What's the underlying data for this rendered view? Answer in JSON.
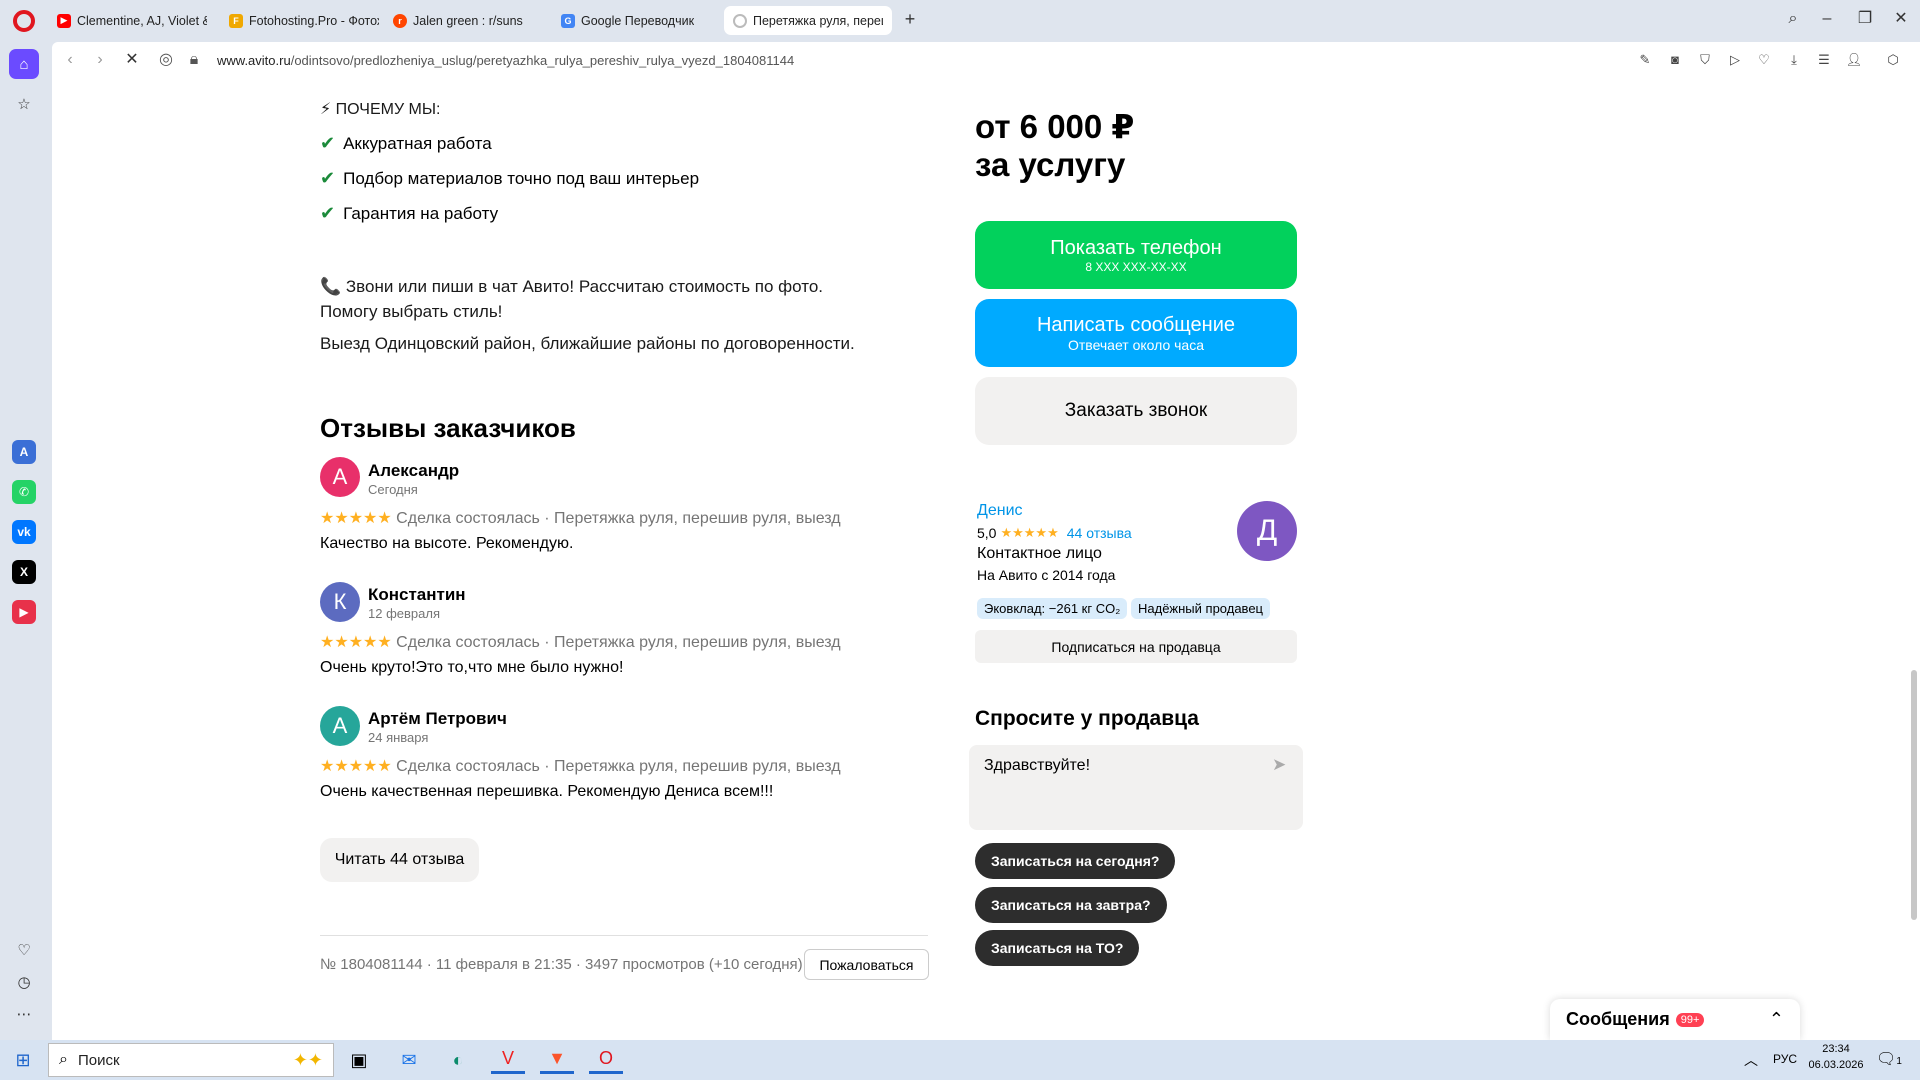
{
  "browser": {
    "tabs": [
      {
        "title": "Clementine, AJ, Violet & L",
        "favicon_color": "#ff0000",
        "favicon": "▶"
      },
      {
        "title": "Fotohosting.Pro - Фотохо",
        "favicon_color": "#f0a800",
        "favicon": "F"
      },
      {
        "title": "Jalen green : r/suns",
        "favicon_color": "#ff4500",
        "favicon": "r"
      },
      {
        "title": "Google Переводчик",
        "favicon_color": "#4285f4",
        "favicon": "G"
      },
      {
        "title": "Перетяжка руля, переши",
        "favicon_color": "#cccccc",
        "favicon": "○"
      }
    ],
    "new_tab": "+",
    "url_host": "www.avito.ru",
    "url_path": "/odintsovo/predlozheniya_uslug/peretyazhka_rulya_pereshiv_rulya_vyezd_1804081144"
  },
  "description": {
    "why_title": "⚡ ПОЧЕМУ МЫ:",
    "bullets": [
      "Аккуратная работа",
      "Подбор материалов точно под ваш интерьер",
      "Гарантия на работу"
    ],
    "call_text": "📞 Звони или пиши в чат Авито! Рассчитаю стоимость по фото. Помогу выбрать стиль!",
    "area_text": "Выезд Одинцовский район, ближайшие районы по договоренности."
  },
  "reviews": {
    "title": "Отзывы заказчиков",
    "items": [
      {
        "initial": "А",
        "avatar_color": "#e8306a",
        "name": "Александр",
        "date": "Сегодня",
        "stars": "★★★★★",
        "deal": "Сделка состоялась · Перетяжка руля, перешив руля, выезд",
        "text": "Качество на высоте. Рекомендую."
      },
      {
        "initial": "К",
        "avatar_color": "#5c6bc0",
        "name": "Константин",
        "date": "12 февраля",
        "stars": "★★★★★",
        "deal": "Сделка состоялась · Перетяжка руля, перешив руля, выезд",
        "text": "Очень круто!Это то,что мне было нужно!"
      },
      {
        "initial": "А",
        "avatar_color": "#26a69a",
        "name": "Артём Петрович",
        "date": "24 января",
        "stars": "★★★★★",
        "deal": "Сделка состоялась · Перетяжка руля, перешив руля, выезд",
        "text": "Очень качественная перешивка. Рекомендую Дениса всем!!!"
      }
    ],
    "read_all": "Читать 44 отзыва"
  },
  "footer": {
    "meta": "№ 1804081144 · 11 февраля в 21:35 · 3497 просмотров (+10 сегодня)",
    "complain": "Пожаловаться"
  },
  "sidebar_right": {
    "price_line1": "от 6 000 ₽",
    "price_line2": "за услугу",
    "show_phone": "Показать телефон",
    "phone_mask": "8 XXX XXX-XX-XX",
    "write_msg": "Написать сообщение",
    "reply_time": "Отвечает около часа",
    "order_call": "Заказать звонок",
    "seller_name": "Денис",
    "rating": "5,0",
    "seller_stars": "★★★★★",
    "reviews_link": "44 отзыва",
    "seller_role": "Контактное лицо",
    "since": "На Авито с 2014 года",
    "seller_initial": "Д",
    "badge1": "Эковклад: −261 кг CO₂",
    "badge2": "Надёжный продавец",
    "subscribe": "Подписаться на продавца",
    "ask_title": "Спросите у продавца",
    "ask_value": "Здравствуйте!",
    "quick": [
      "Записаться на сегодня?",
      "Записаться на завтра?",
      "Записаться на ТО?"
    ]
  },
  "messages": {
    "label": "Сообщения",
    "badge": "99+"
  },
  "taskbar": {
    "search_placeholder": "Поиск",
    "lang": "РУС",
    "time": "23:34",
    "date": "06.03.2026",
    "notif": "1"
  },
  "colors": {
    "green": "#02d15c",
    "blue": "#00aaff",
    "link": "#0094e7"
  }
}
